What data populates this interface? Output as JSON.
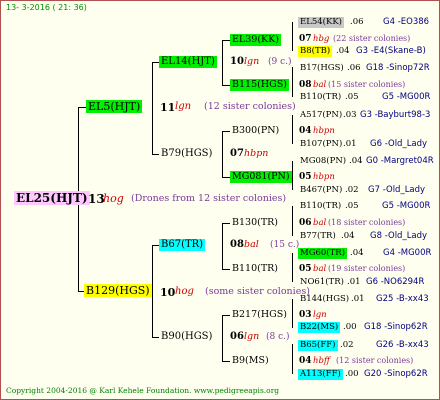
{
  "date": "13- 3-2016 ( 21: 36)",
  "footer": "Copyright 2004-2016 @ Karl Kehele Foundation.    www.pedigreeapis.org",
  "root": {
    "name": "EL25(HJT)",
    "num": "13",
    "code": "hog",
    "note": "(Drones from 12 sister colonies)"
  },
  "g1": [
    {
      "name": "EL5(HJT)",
      "num": "11",
      "code": "lgn",
      "note": "(12 sister colonies)"
    },
    {
      "name": "B129(HGS)",
      "num": "10",
      "code": "hog",
      "note": "(some sister colonies)"
    }
  ],
  "g2": [
    {
      "name": "EL14(HJT)",
      "num": "10",
      "code": "lgn",
      "note": "(9 c.)"
    },
    {
      "name": "B79(HGS)",
      "num": "07",
      "code": "hbpn",
      "note": ""
    },
    {
      "name": "B67(TR)",
      "num": "08",
      "code": "bal",
      "note": "(15 c.)"
    },
    {
      "name": "B90(HGS)",
      "num": "06",
      "code": "lgn",
      "note": "(8 c.)"
    }
  ],
  "g3": [
    {
      "name": "EL39(KK)",
      "num": "07",
      "code": "hbg",
      "note": "(22 sister colonies)"
    },
    {
      "name": "B115(HGS)",
      "num": "08",
      "code": "bal",
      "note": "(15 sister colonies)"
    },
    {
      "name": "B300(PN)",
      "num": "04",
      "code": "hbpn",
      "note": ""
    },
    {
      "name": "MG081(PN)",
      "num": "05",
      "code": "hbpn",
      "note": ""
    },
    {
      "name": "B130(TR)",
      "num": "06",
      "code": "bal",
      "note": "(18 sister colonies)"
    },
    {
      "name": "B110(TR)",
      "num": "05",
      "code": "bal",
      "note": "(19 sister colonies)"
    },
    {
      "name": "B217(HGS)",
      "num": "03",
      "code": "lgn",
      "note": ""
    },
    {
      "name": "B9(MS)",
      "num": "04",
      "code": "hbff",
      "note": "(12 sister colonies)"
    }
  ],
  "g4": [
    {
      "name": "EL54(KK)",
      "val": ".06",
      "gen": "G4 -EO386"
    },
    {
      "name": "B8(TB)",
      "val": ".04",
      "gen": "G3 -E4(Skane-B)"
    },
    {
      "name": "B17(HGS)",
      "val": ".06",
      "gen": "G18 -Sinop72R"
    },
    {
      "name": "B110(TR)",
      "val": ".05",
      "gen": "G5 -MG00R"
    },
    {
      "name": "A517(PN)",
      "val": ".03",
      "gen": "G3 -Bayburt98-3"
    },
    {
      "name": "B107(PN)",
      "val": ".01",
      "gen": "G6 -Old_Lady"
    },
    {
      "name": "MG08(PN)",
      "val": ".04",
      "gen": "G0 -Margret04R"
    },
    {
      "name": "B467(PN)",
      "val": ".02",
      "gen": "G7 -Old_Lady"
    },
    {
      "name": "B110(TR)",
      "val": ".05",
      "gen": "G5 -MG00R"
    },
    {
      "name": "B77(TR)",
      "val": ".04",
      "gen": "G8 -Old_Lady"
    },
    {
      "name": "MG60(TR)",
      "val": ".04",
      "gen": "G4 -MG00R"
    },
    {
      "name": "NO61(TR)",
      "val": ".01",
      "gen": "G6 -NO6294R"
    },
    {
      "name": "B144(HGS)",
      "val": ".01",
      "gen": "G25 -B-xx43"
    },
    {
      "name": "B22(MS)",
      "val": ".00",
      "gen": "G18 -Sinop62R"
    },
    {
      "name": "B65(FF)",
      "val": ".02",
      "gen": "G26 -B-xx43"
    },
    {
      "name": "A113(FF)",
      "val": ".00",
      "gen": "G20 -Sinop62R"
    }
  ],
  "colors": {
    "pink": "#ffc8ff",
    "green": "#00ee00",
    "yellow": "#ffff00",
    "cyan": "#00ffff",
    "grey": "#c8c8c8"
  }
}
